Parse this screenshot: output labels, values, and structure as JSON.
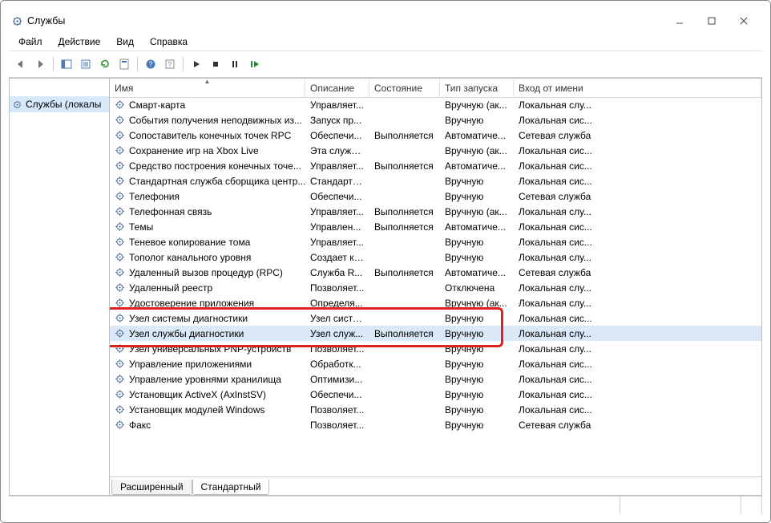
{
  "window": {
    "title": "Службы"
  },
  "menubar": [
    "Файл",
    "Действие",
    "Вид",
    "Справка"
  ],
  "tree": {
    "root": "Службы (локалы"
  },
  "columns": {
    "name": "Имя",
    "desc": "Описание",
    "state": "Состояние",
    "start": "Тип запуска",
    "logon": "Вход от имени"
  },
  "tabs": {
    "extended": "Расширенный",
    "standard": "Стандартный"
  },
  "rows": [
    {
      "name": "Смарт-карта",
      "desc": "Управляет...",
      "state": "",
      "start": "Вручную (ак...",
      "logon": "Локальная слу..."
    },
    {
      "name": "События получения неподвижных из...",
      "desc": "Запуск пр...",
      "state": "",
      "start": "Вручную",
      "logon": "Локальная сис..."
    },
    {
      "name": "Сопоставитель конечных точек RPC",
      "desc": "Обеспечи...",
      "state": "Выполняется",
      "start": "Автоматиче...",
      "logon": "Сетевая служба"
    },
    {
      "name": "Сохранение игр на Xbox Live",
      "desc": "Эта служб...",
      "state": "",
      "start": "Вручную (ак...",
      "logon": "Локальная сис..."
    },
    {
      "name": "Средство построения конечных точе...",
      "desc": "Управляет...",
      "state": "Выполняется",
      "start": "Автоматиче...",
      "logon": "Локальная сис..."
    },
    {
      "name": "Стандартная служба сборщика центр...",
      "desc": "Стандартн...",
      "state": "",
      "start": "Вручную",
      "logon": "Локальная сис..."
    },
    {
      "name": "Телефония",
      "desc": "Обеспечи...",
      "state": "",
      "start": "Вручную",
      "logon": "Сетевая служба"
    },
    {
      "name": "Телефонная связь",
      "desc": "Управляет...",
      "state": "Выполняется",
      "start": "Вручную (ак...",
      "logon": "Локальная слу..."
    },
    {
      "name": "Темы",
      "desc": "Управлен...",
      "state": "Выполняется",
      "start": "Автоматиче...",
      "logon": "Локальная сис..."
    },
    {
      "name": "Теневое копирование тома",
      "desc": "Управляет...",
      "state": "",
      "start": "Вручную",
      "logon": "Локальная сис..."
    },
    {
      "name": "Тополог канального уровня",
      "desc": "Создает ка...",
      "state": "",
      "start": "Вручную",
      "logon": "Локальная слу..."
    },
    {
      "name": "Удаленный вызов процедур (RPC)",
      "desc": "Служба R...",
      "state": "Выполняется",
      "start": "Автоматиче...",
      "logon": "Сетевая служба"
    },
    {
      "name": "Удаленный реестр",
      "desc": "Позволяет...",
      "state": "",
      "start": "Отключена",
      "logon": "Локальная слу..."
    },
    {
      "name": "Удостоверение приложения",
      "desc": "Определя...",
      "state": "",
      "start": "Вручную (ак...",
      "logon": "Локальная слу..."
    },
    {
      "name": "Узел системы диагностики",
      "desc": "Узел систе...",
      "state": "",
      "start": "Вручную",
      "logon": "Локальная сис..."
    },
    {
      "name": "Узел службы диагностики",
      "desc": "Узел служ...",
      "state": "Выполняется",
      "start": "Вручную",
      "logon": "Локальная слу...",
      "selected": true
    },
    {
      "name": "Узел универсальных PNP-устройств",
      "desc": "Позволяет...",
      "state": "",
      "start": "Вручную",
      "logon": "Локальная слу..."
    },
    {
      "name": "Управление приложениями",
      "desc": "Обработк...",
      "state": "",
      "start": "Вручную",
      "logon": "Локальная сис..."
    },
    {
      "name": "Управление уровнями хранилища",
      "desc": "Оптимизи...",
      "state": "",
      "start": "Вручную",
      "logon": "Локальная сис..."
    },
    {
      "name": "Установщик ActiveX (AxInstSV)",
      "desc": "Обеспечи...",
      "state": "",
      "start": "Вручную",
      "logon": "Локальная сис..."
    },
    {
      "name": "Установщик модулей Windows",
      "desc": "Позволяет...",
      "state": "",
      "start": "Вручную",
      "logon": "Локальная сис..."
    },
    {
      "name": "Факс",
      "desc": "Позволяет...",
      "state": "",
      "start": "Вручную",
      "logon": "Сетевая служба"
    }
  ],
  "highlight": {
    "row_start": 14,
    "row_count": 2
  }
}
